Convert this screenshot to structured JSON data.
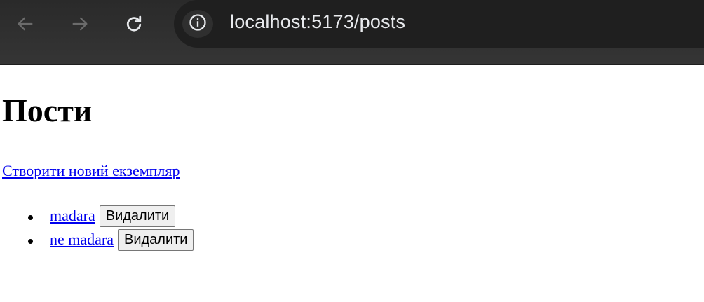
{
  "browser": {
    "url": "localhost:5173/posts",
    "back_icon": "arrow-left-icon",
    "forward_icon": "arrow-right-icon",
    "reload_icon": "reload-icon",
    "site_info_icon": "info-circle-icon",
    "toolbar_color": "#2d2d2d",
    "omnibox_color": "#1f1f1f"
  },
  "page": {
    "title": "Пости",
    "create_link": "Створити новий екземпляр",
    "link_color": "#0000ee",
    "posts": [
      {
        "name": "madara",
        "delete_label": "Видалити"
      },
      {
        "name": "ne madara",
        "delete_label": "Видалити"
      }
    ]
  }
}
